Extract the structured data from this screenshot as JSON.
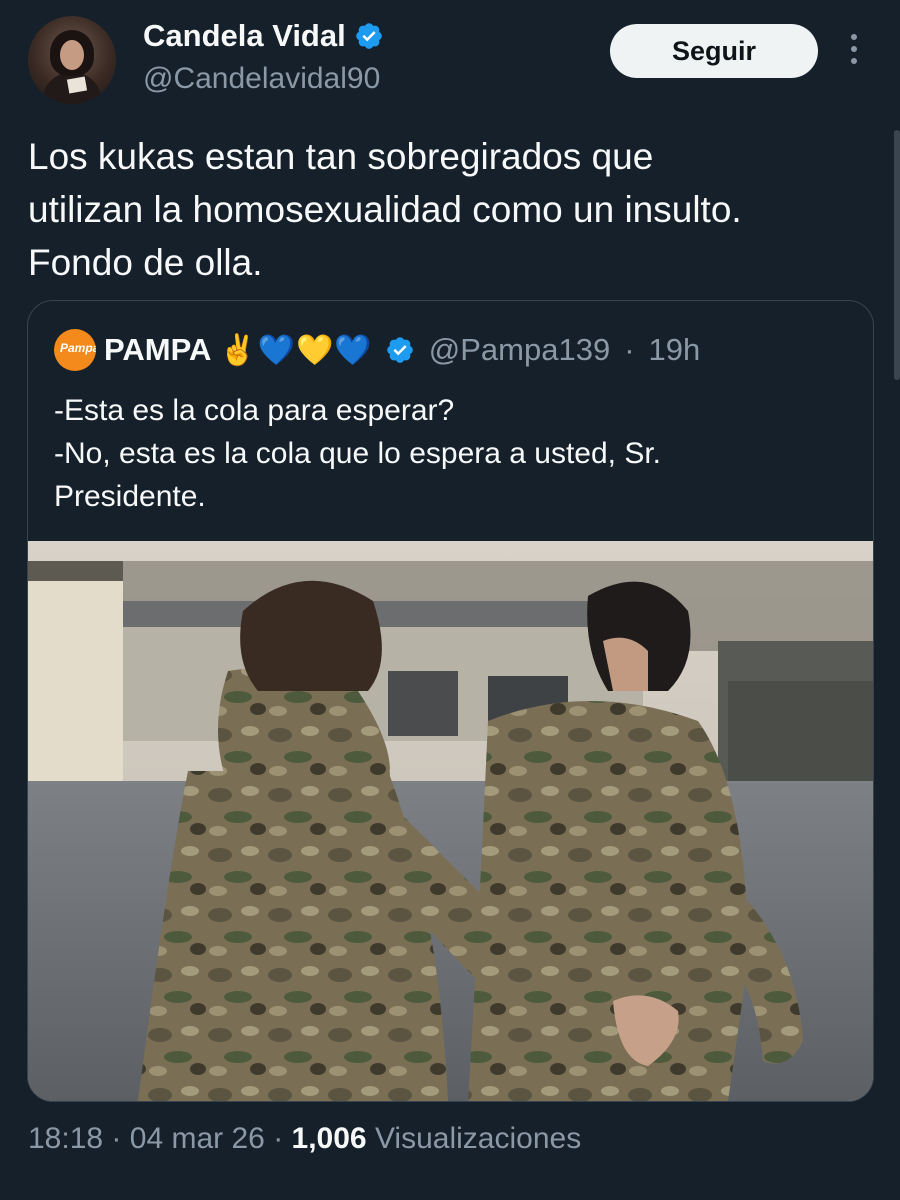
{
  "author": {
    "display_name": "Candela Vidal",
    "handle": "@Candelavidal90",
    "follow_label": "Seguir"
  },
  "tweet": {
    "text": "Los kukas estan tan sobregirados que\nutilizan la homosexualidad como un insulto.\nFondo de olla."
  },
  "quoted": {
    "avatar_text": "Pampa",
    "display_name": "PAMPA",
    "emojis": "✌️💙💛💙",
    "handle": "@Pampa139",
    "separator": "·",
    "time": "19h",
    "text": "-Esta es la cola para esperar?\n-No, esta es la cola que lo espera a usted, Sr.\nPresidente."
  },
  "meta": {
    "time": "18:18",
    "separator": "·",
    "date": "04 mar 26",
    "views_count": "1,006",
    "views_label": "Visualizaciones"
  },
  "colors": {
    "background": "#15202b",
    "verified_blue": "#1d9bf0",
    "secondary_text": "#8b98a5",
    "border": "#38444d"
  },
  "icons": [
    "verified-badge-icon",
    "more-options-icon"
  ]
}
